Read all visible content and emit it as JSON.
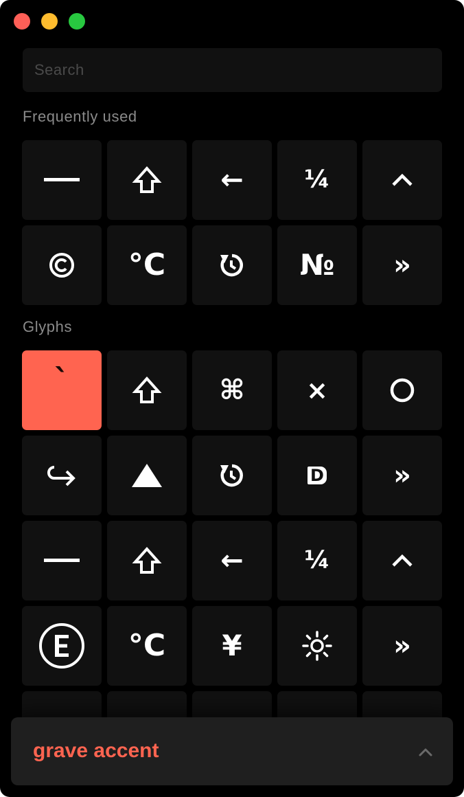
{
  "window": {
    "traffic_lights": [
      "close",
      "minimize",
      "zoom"
    ]
  },
  "search": {
    "placeholder": "Search",
    "value": ""
  },
  "sections": {
    "frequent": {
      "title": "Frequently used",
      "items": [
        {
          "glyph": "",
          "icon": "em-dash-icon"
        },
        {
          "glyph": "",
          "icon": "shift-arrow-icon"
        },
        {
          "glyph": "←",
          "icon": "left-arrow-icon"
        },
        {
          "glyph": "¼",
          "icon": "one-quarter-icon"
        },
        {
          "glyph": "",
          "icon": "caret-up-icon"
        },
        {
          "glyph": "",
          "icon": "copyright-icon"
        },
        {
          "glyph": "°C",
          "icon": "degree-celsius-icon"
        },
        {
          "glyph": "",
          "icon": "restore-icon"
        },
        {
          "glyph": "№",
          "icon": "numero-icon"
        },
        {
          "glyph": "»",
          "icon": "right-guillemet-icon"
        }
      ]
    },
    "glyphs": {
      "title": "Glyphs",
      "items": [
        {
          "glyph": "`",
          "icon": "grave-accent-icon",
          "selected": true
        },
        {
          "glyph": "",
          "icon": "shift-arrow-icon"
        },
        {
          "glyph": "⌘",
          "icon": "command-key-icon"
        },
        {
          "glyph": "×",
          "icon": "multiplication-icon"
        },
        {
          "glyph": "",
          "icon": "circle-icon"
        },
        {
          "glyph": "",
          "icon": "hook-arrow-icon"
        },
        {
          "glyph": "",
          "icon": "triangle-up-icon"
        },
        {
          "glyph": "",
          "icon": "restore-icon"
        },
        {
          "glyph": "D",
          "icon": "d-badge-icon"
        },
        {
          "glyph": "»",
          "icon": "right-guillemet-icon"
        },
        {
          "glyph": "",
          "icon": "em-dash-icon"
        },
        {
          "glyph": "",
          "icon": "shift-arrow-icon"
        },
        {
          "glyph": "←",
          "icon": "left-arrow-icon"
        },
        {
          "glyph": "¼",
          "icon": "one-quarter-icon"
        },
        {
          "glyph": "",
          "icon": "caret-up-icon"
        },
        {
          "glyph": "",
          "icon": "circled-e-icon"
        },
        {
          "glyph": "°C",
          "icon": "degree-celsius-icon"
        },
        {
          "glyph": "¥",
          "icon": "yen-icon"
        },
        {
          "glyph": "",
          "icon": "sun-icon"
        },
        {
          "glyph": "»",
          "icon": "right-guillemet-icon"
        },
        {
          "glyph": "",
          "icon": "glyph-tile-blank"
        },
        {
          "glyph": "",
          "icon": "glyph-tile-blank"
        },
        {
          "glyph": "",
          "icon": "glyph-tile-blank"
        },
        {
          "glyph": "",
          "icon": "glyph-tile-blank"
        },
        {
          "glyph": "",
          "icon": "glyph-tile-blank"
        }
      ]
    }
  },
  "footer": {
    "selected_name": "grave accent",
    "chevron_icon": "chevron-up-icon"
  },
  "colors": {
    "background": "#000000",
    "tile": "#111111",
    "accent": "#ff6450",
    "section_title": "#8a8a8a"
  }
}
